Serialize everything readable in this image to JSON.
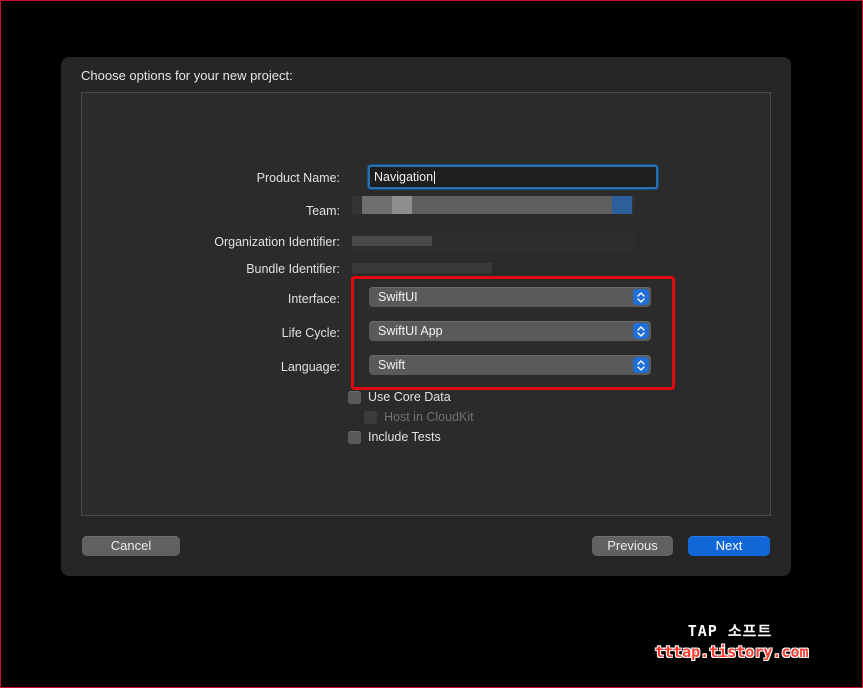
{
  "dialog": {
    "title": "Choose options for your new project:",
    "fields": {
      "product_name": {
        "label": "Product Name:",
        "value": "Navigation"
      },
      "team": {
        "label": "Team:"
      },
      "organization_identifier": {
        "label": "Organization Identifier:"
      },
      "bundle_identifier": {
        "label": "Bundle Identifier:"
      }
    },
    "popups": {
      "interface": {
        "label": "Interface:",
        "value": "SwiftUI"
      },
      "life_cycle": {
        "label": "Life Cycle:",
        "value": "SwiftUI App"
      },
      "language": {
        "label": "Language:",
        "value": "Swift"
      }
    },
    "checkboxes": {
      "use_core_data": {
        "label": "Use Core Data",
        "checked": false
      },
      "host_in_cloudkit": {
        "label": "Host in CloudKit",
        "checked": false,
        "enabled": false
      },
      "include_tests": {
        "label": "Include Tests",
        "checked": false
      }
    },
    "buttons": {
      "cancel": "Cancel",
      "previous": "Previous",
      "next": "Next"
    }
  },
  "watermark": {
    "line1": "TAP 소프트",
    "line2": "tttap.tistory.com"
  },
  "colors": {
    "accent": "#1167d8",
    "highlight": "#e30613",
    "sheet_bg": "#262626"
  }
}
